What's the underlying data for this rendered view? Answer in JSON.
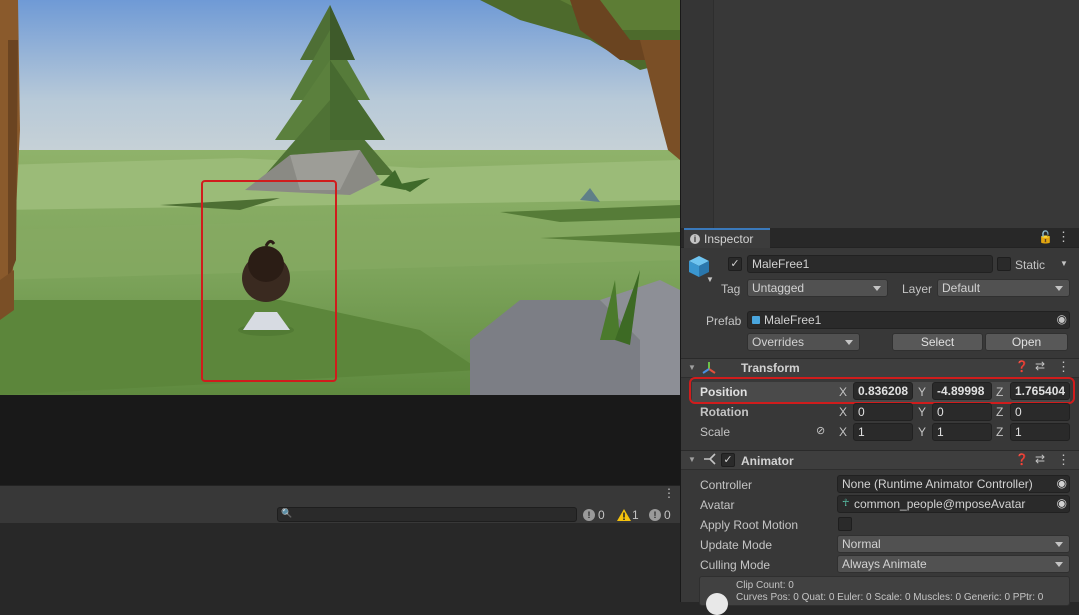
{
  "console": {
    "search_placeholder": "",
    "log_count": "0",
    "warn_count": "1",
    "error_count": "0"
  },
  "inspector": {
    "tab_label": "Inspector",
    "object": {
      "name": "MaleFree1",
      "active": true,
      "static_label": "Static",
      "tag_label": "Tag",
      "tag_value": "Untagged",
      "layer_label": "Layer",
      "layer_value": "Default"
    },
    "prefab": {
      "label": "Prefab",
      "asset": "MaleFree1",
      "overrides_label": "Overrides",
      "select_label": "Select",
      "open_label": "Open"
    },
    "transform": {
      "title": "Transform",
      "position": {
        "label": "Position",
        "x": "0.836208",
        "y": "-4.89998",
        "z": "1.765404"
      },
      "rotation": {
        "label": "Rotation",
        "x": "0",
        "y": "0",
        "z": "0"
      },
      "scale": {
        "label": "Scale",
        "x": "1",
        "y": "1",
        "z": "1"
      }
    },
    "animator": {
      "title": "Animator",
      "controller_label": "Controller",
      "controller_value": "None (Runtime Animator Controller)",
      "avatar_label": "Avatar",
      "avatar_value": "common_people@mposeAvatar",
      "apply_root_motion_label": "Apply Root Motion",
      "update_mode_label": "Update Mode",
      "update_mode_value": "Normal",
      "culling_mode_label": "Culling Mode",
      "culling_mode_value": "Always Animate",
      "info_line1": "Clip Count: 0",
      "info_line2": "Curves Pos: 0 Quat: 0 Euler: 0 Scale: 0 Muscles: 0 Generic: 0 PPtr: 0"
    }
  },
  "axes": {
    "x": "X",
    "y": "Y",
    "z": "Z"
  },
  "colors": {
    "accent": "#3a79bb",
    "highlight": "#d01c1c",
    "panel": "#383838"
  }
}
